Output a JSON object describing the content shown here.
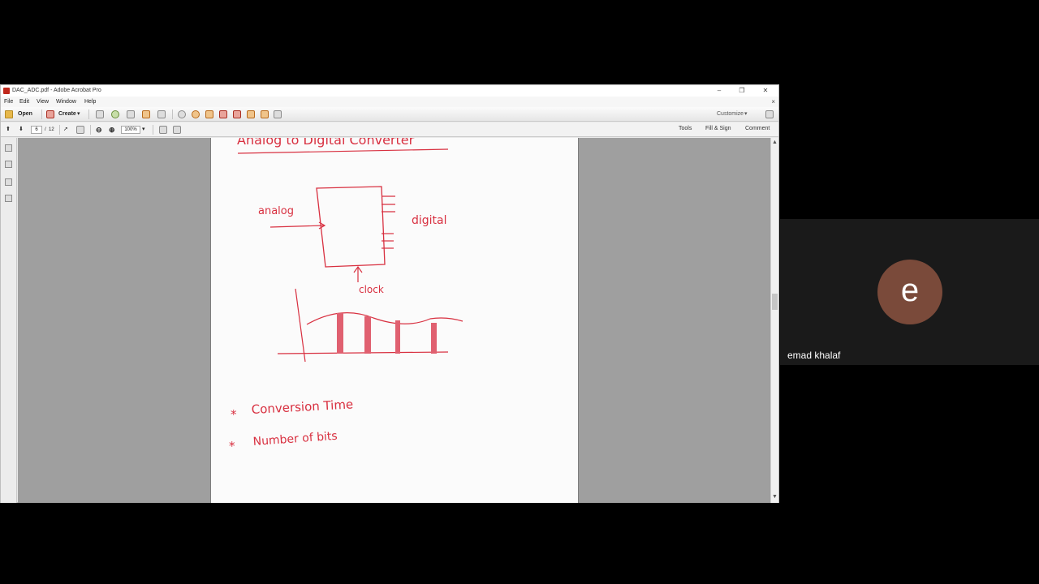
{
  "window": {
    "title": "DAC_ADC.pdf - Adobe Acrobat Pro",
    "controls": {
      "minimize": "–",
      "restore": "❐",
      "close": "✕"
    }
  },
  "menu": {
    "items": [
      "File",
      "Edit",
      "View",
      "Window",
      "Help"
    ],
    "close": "×"
  },
  "toolbar": {
    "open_label": "Open",
    "create_label": "Create",
    "customize_label": "Customize"
  },
  "nav": {
    "current_page": "6",
    "page_sep": "/",
    "total_pages": "12",
    "zoom": "100%"
  },
  "panes": {
    "tools": "Tools",
    "fill_sign": "Fill & Sign",
    "comment": "Comment"
  },
  "page": {
    "heading": "Analog to Digital Converter",
    "input_label": "analog",
    "output_label": "digital",
    "clock_label": "clock",
    "bullets": [
      "Conversion Time",
      "Number of bits"
    ],
    "bullet_marker": "*"
  },
  "participant": {
    "initial": "e",
    "name": "emad khalaf",
    "avatar_color": "#7a4a3a"
  },
  "colors": {
    "ink": "#d83040",
    "doc_background": "#9f9f9f"
  }
}
